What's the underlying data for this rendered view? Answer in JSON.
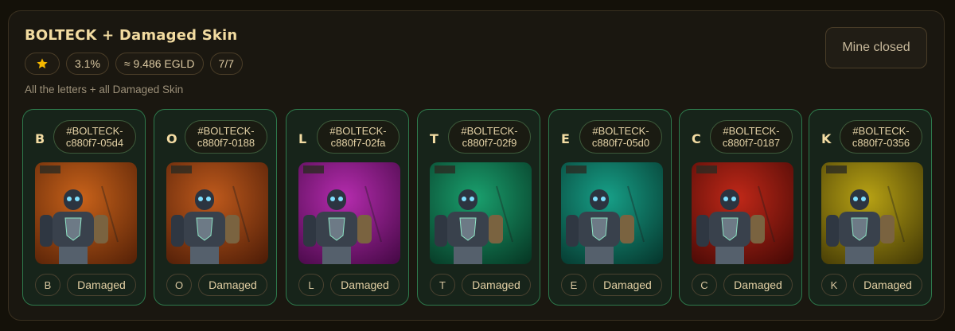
{
  "collection": {
    "title": "BOLTECK + Damaged Skin",
    "chips": {
      "star_icon": "star-icon",
      "percent": "3.1%",
      "price": "≈ 9.486 EGLD",
      "progress": "7/7"
    },
    "description": "All the letters + all Damaged Skin",
    "status_button": "Mine closed"
  },
  "colors": {
    "accent_border": "#2e7a4c",
    "title": "#f2dba0",
    "star": "#f5b800"
  },
  "cards": [
    {
      "letter": "B",
      "token_id": "#BOLTECK-c880f7-05d4",
      "letter_attr": "B",
      "skin": "Damaged",
      "bg": "#c8621a",
      "bg_dark": "#5a2408"
    },
    {
      "letter": "O",
      "token_id": "#BOLTECK-c880f7-0188",
      "letter_attr": "O",
      "skin": "Damaged",
      "bg": "#bf5a1c",
      "bg_dark": "#521f08"
    },
    {
      "letter": "L",
      "token_id": "#BOLTECK-c880f7-02fa",
      "letter_attr": "L",
      "skin": "Damaged",
      "bg": "#b52cae",
      "bg_dark": "#4a0a4a"
    },
    {
      "letter": "T",
      "token_id": "#BOLTECK-c880f7-02f9",
      "letter_attr": "T",
      "skin": "Damaged",
      "bg": "#1aa06e",
      "bg_dark": "#073a26"
    },
    {
      "letter": "E",
      "token_id": "#BOLTECK-c880f7-05d0",
      "letter_attr": "E",
      "skin": "Damaged",
      "bg": "#17a088",
      "bg_dark": "#063a30"
    },
    {
      "letter": "C",
      "token_id": "#BOLTECK-c880f7-0187",
      "letter_attr": "C",
      "skin": "Damaged",
      "bg": "#c02818",
      "bg_dark": "#4a0a06"
    },
    {
      "letter": "K",
      "token_id": "#BOLTECK-c880f7-0356",
      "letter_attr": "K",
      "skin": "Damaged",
      "bg": "#b8a214",
      "bg_dark": "#463c06"
    }
  ]
}
